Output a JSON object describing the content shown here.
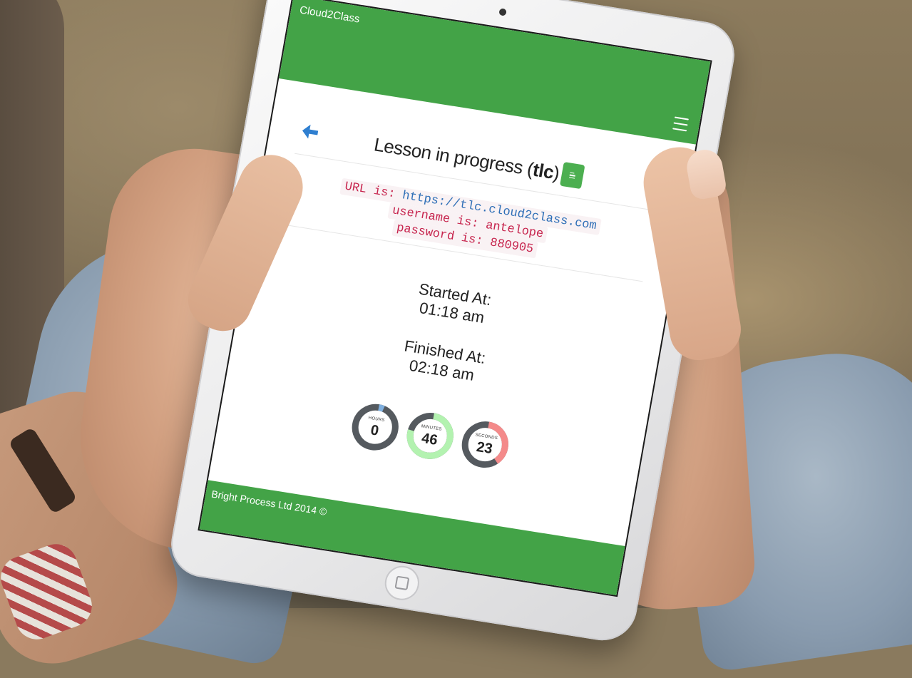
{
  "app": {
    "brand": "Cloud2Class"
  },
  "lesson": {
    "title_prefix": "Lesson in progress (",
    "title_code": "tlc",
    "title_suffix": ")"
  },
  "credentials": {
    "url_label": "URL is:",
    "url_value": "https://tlc.cloud2class.com",
    "username_label": "username is:",
    "username_value": "antelope",
    "password_label": "password is:",
    "password_value": "880905"
  },
  "times": {
    "started_label": "Started At:",
    "started_value": "01:18 am",
    "finished_label": "Finished At:",
    "finished_value": "02:18 am"
  },
  "gauges": [
    {
      "label": "HOURS",
      "value": "0",
      "fraction": 0.04,
      "track": "#555a5f",
      "fill": "#7fb0e0"
    },
    {
      "label": "MINUTES",
      "value": "46",
      "fraction": 0.77,
      "track": "#555a5f",
      "fill": "#b3f2b0"
    },
    {
      "label": "SECONDS",
      "value": "23",
      "fraction": 0.38,
      "track": "#555a5f",
      "fill": "#f48a8a"
    }
  ],
  "footer": {
    "text": "Bright Process Ltd 2014 ©"
  },
  "colors": {
    "brand_green": "#43a347",
    "code_red": "#c7254e",
    "link_blue": "#2f6fb7"
  },
  "icons": {
    "back": "arrow-left-icon",
    "menu": "hamburger-menu-icon",
    "doc": "document-list-icon"
  }
}
